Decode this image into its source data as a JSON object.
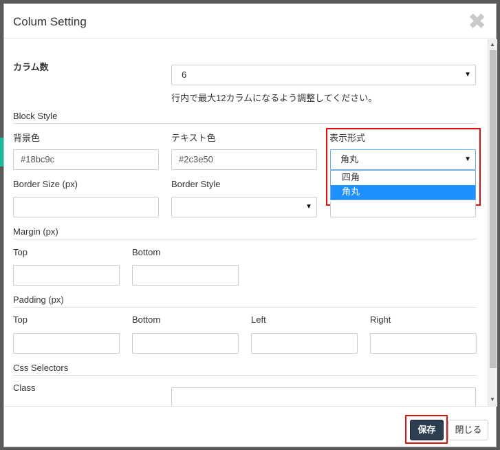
{
  "modal": {
    "title": "Colum Setting",
    "close_glyph": "✖"
  },
  "columns": {
    "label": "カラム数",
    "value": "6",
    "help": "行内で最大12カラムになるよう調整してください。"
  },
  "block_style": {
    "heading": "Block Style",
    "bg_color_label": "背景色",
    "bg_color_value": "#18bc9c",
    "text_color_label": "テキスト色",
    "text_color_value": "#2c3e50",
    "display_label": "表示形式",
    "display_value": "角丸",
    "display_options": [
      "四角",
      "角丸"
    ],
    "border_size_label": "Border Size (px)",
    "border_size_value": "",
    "border_style_label": "Border Style",
    "border_style_value": ""
  },
  "margin": {
    "heading": "Margin (px)",
    "top_label": "Top",
    "bottom_label": "Bottom"
  },
  "padding": {
    "heading": "Padding (px)",
    "top_label": "Top",
    "bottom_label": "Bottom",
    "left_label": "Left",
    "right_label": "Right"
  },
  "css": {
    "heading": "Css Selectors",
    "class_label": "Class",
    "class_value": ""
  },
  "footer": {
    "save_label": "保存",
    "close_label": "閉じる"
  },
  "colors": {
    "accent": "#18bc9c",
    "primary": "#2c3e50",
    "highlight": "#e01010",
    "selected_option": "#1e90ff"
  }
}
